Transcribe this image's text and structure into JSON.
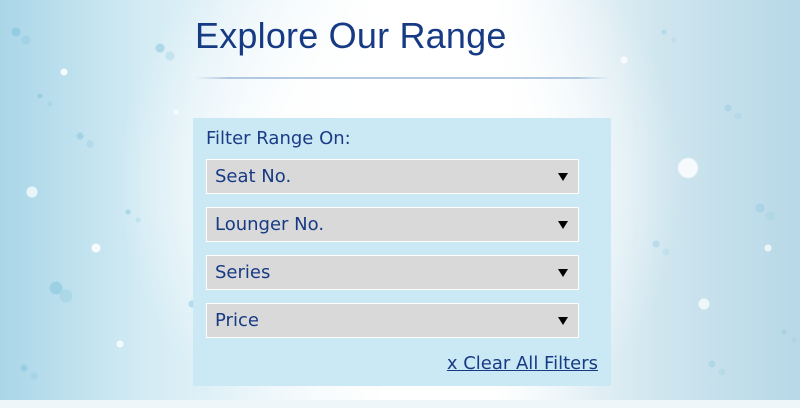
{
  "header": {
    "title": "Explore Our Range"
  },
  "filters": {
    "label": "Filter Range On:",
    "options": [
      {
        "label": "Seat No."
      },
      {
        "label": "Lounger No."
      },
      {
        "label": "Series"
      },
      {
        "label": "Price"
      }
    ],
    "clear_label": "x Clear All Filters"
  },
  "colors": {
    "title_text": "#173a84",
    "panel_background": "#cbe9f4",
    "select_background": "#d9d9d9",
    "select_border": "#ffffff",
    "link_text": "#173a84"
  },
  "icons": {
    "dropdown": "chevron-down-icon"
  }
}
